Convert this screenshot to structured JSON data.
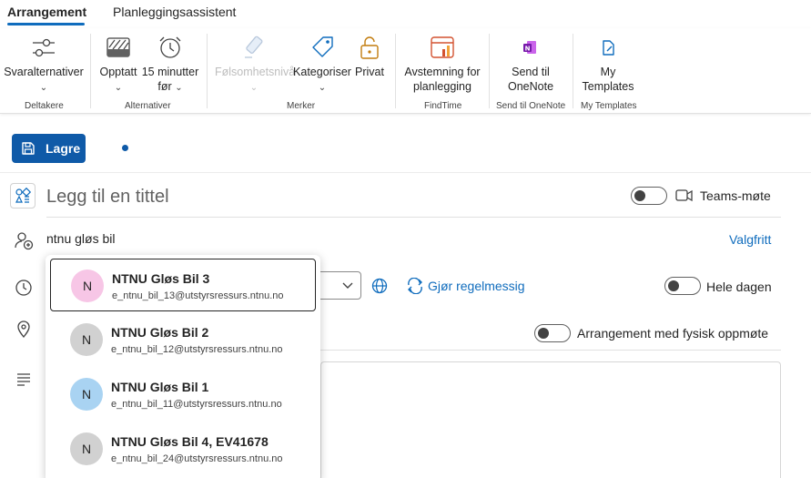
{
  "tabs": [
    {
      "label": "Arrangement",
      "active": true
    },
    {
      "label": "Planleggingsassistent",
      "active": false
    }
  ],
  "ribbon": {
    "groups": [
      {
        "label": "Deltakere",
        "buttons": [
          {
            "label": "Svaralternativer",
            "icon": "sliders-icon"
          }
        ]
      },
      {
        "label": "Alternativer",
        "buttons": [
          {
            "label": "Opptatt",
            "icon": "busy-pattern-icon"
          },
          {
            "label": "15 minutter",
            "label2": "før",
            "icon": "alarm-clock-icon"
          }
        ]
      },
      {
        "label": "Merker",
        "buttons": [
          {
            "label": "Følsomhetsnivå",
            "icon": "sensitivity-icon",
            "disabled": true
          },
          {
            "label": "Kategoriser",
            "icon": "tag-icon"
          },
          {
            "label": "Privat",
            "icon": "lock-icon"
          }
        ]
      },
      {
        "label": "FindTime",
        "buttons": [
          {
            "label": "Avstemning for",
            "label2": "planlegging",
            "icon": "findtime-icon"
          }
        ]
      },
      {
        "label": "Send til OneNote",
        "buttons": [
          {
            "label": "Send til",
            "label2": "OneNote",
            "icon": "onenote-icon"
          }
        ]
      },
      {
        "label": "My Templates",
        "buttons": [
          {
            "label": "My",
            "label2": "Templates",
            "icon": "templates-icon"
          }
        ]
      }
    ]
  },
  "command_bar": {
    "save_label": "Lagre"
  },
  "form": {
    "title_placeholder": "Legg til en tittel",
    "teams_label": "Teams-møte",
    "attendee_value": "ntnu gløs bil",
    "optional_link": "Valgfritt",
    "recurring_link": "Gjør regelmessig",
    "all_day_label": "Hele dagen",
    "in_person_label": "Arrangement med fysisk oppmøte"
  },
  "suggestions": [
    {
      "name": "NTNU Gløs Bil 3",
      "email": "e_ntnu_bil_13@utstyrsressurs.ntnu.no",
      "initial": "N",
      "color": "#f7c6e6",
      "selected": true
    },
    {
      "name": "NTNU Gløs Bil 2",
      "email": "e_ntnu_bil_12@utstyrsressurs.ntnu.no",
      "initial": "N",
      "color": "#d1d1d1",
      "selected": false
    },
    {
      "name": "NTNU Gløs Bil 1",
      "email": "e_ntnu_bil_11@utstyrsressurs.ntnu.no",
      "initial": "N",
      "color": "#a9d3f2",
      "selected": false
    },
    {
      "name": "NTNU Gløs Bil 4, EV41678",
      "email": "e_ntnu_bil_24@utstyrsressurs.ntnu.no",
      "initial": "N",
      "color": "#d1d1d1",
      "selected": false
    }
  ],
  "colors": {
    "accent": "#0f6cbd",
    "save_button": "#0f5aa8"
  }
}
